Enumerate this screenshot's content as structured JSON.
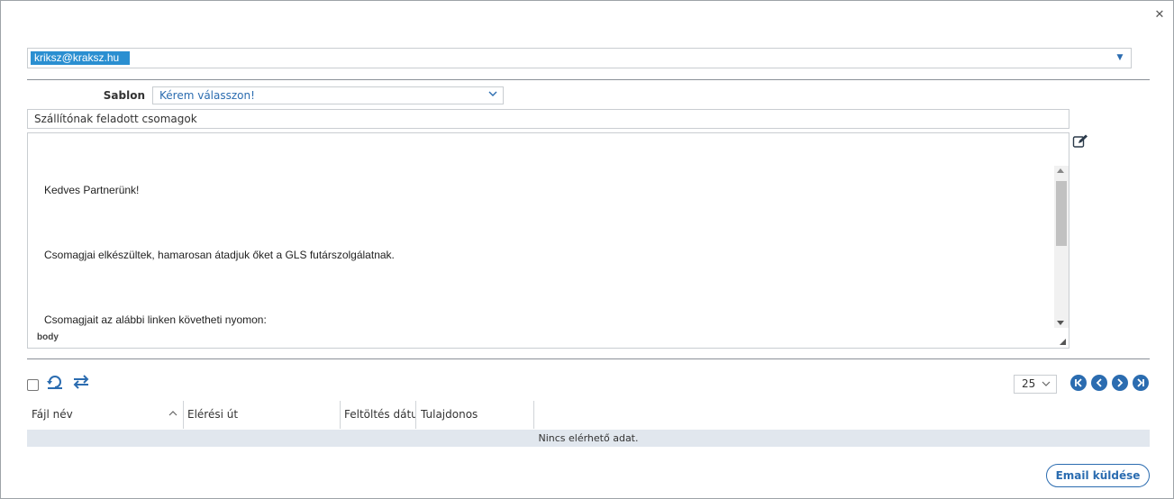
{
  "recipients": {
    "items": [
      "kriksz@kraksz.hu"
    ]
  },
  "template": {
    "label": "Sablon",
    "value": "Kérem válasszon!"
  },
  "subject": {
    "value": "Szállítónak feladott csomagok"
  },
  "body": {
    "paragraphs": [
      "Kedves Partnerünk!",
      "Csomagjai elkészültek, hamarosan átadjuk őket a GLS futárszolgálatnak.",
      "Csomagjait az alábbi linken követheti nyomon:"
    ],
    "status_path": "body"
  },
  "attachments": {
    "page_size": "25",
    "columns": [
      "Fájl név",
      "Elérési út",
      "Feltöltés dátu",
      "Tulajdonos"
    ],
    "empty_text": "Nincs elérhető adat."
  },
  "actions": {
    "send_label": "Email küldése"
  },
  "colors": {
    "accent": "#2b6cb0",
    "chip": "#2a8fd1",
    "empty_row": "#e1e7ee"
  }
}
